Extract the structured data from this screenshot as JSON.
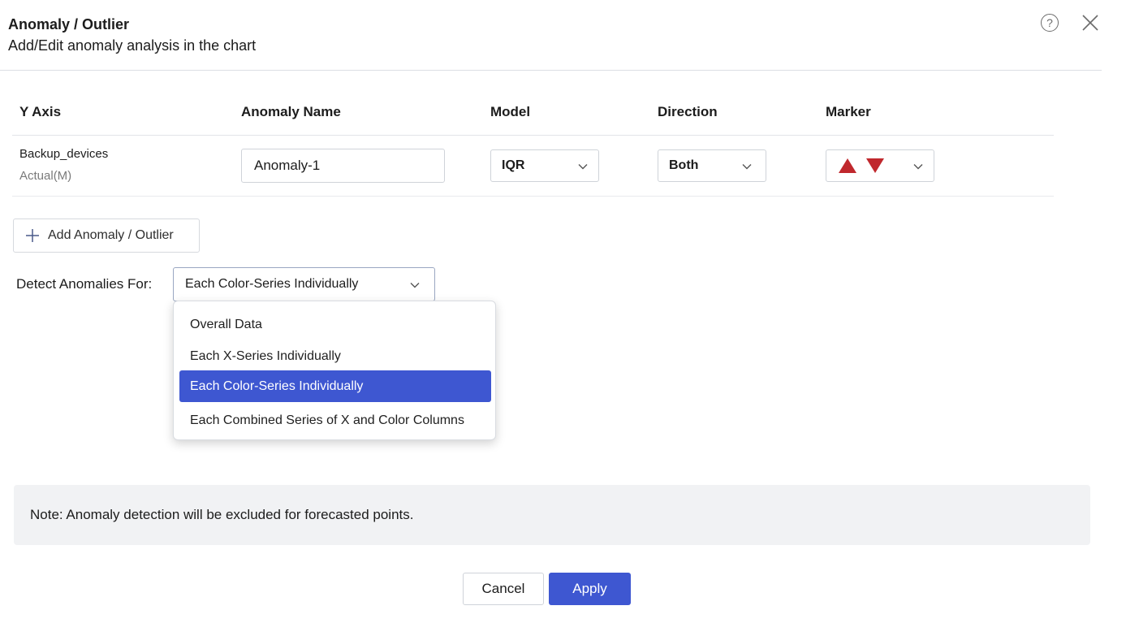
{
  "header": {
    "title": "Anomaly / Outlier",
    "subtitle": "Add/Edit anomaly analysis in the chart",
    "help_glyph": "?",
    "help_icon": "question-circle-icon",
    "close_icon": "close-icon"
  },
  "table": {
    "columns": [
      "Y Axis",
      "Anomaly Name",
      "Model",
      "Direction",
      "Marker"
    ],
    "rows": [
      {
        "y_axis_name": "Backup_devices",
        "y_axis_sub": "Actual(M)",
        "anomaly_name": "Anomaly-1",
        "model": "IQR",
        "direction": "Both",
        "marker_icons": [
          "triangle-up-icon",
          "triangle-down-icon"
        ],
        "marker_color": "#c0282d"
      }
    ]
  },
  "add_button": {
    "label": "Add Anomaly / Outlier",
    "icon": "plus-icon"
  },
  "detect": {
    "label": "Detect Anomalies For:",
    "selected": "Each Color-Series Individually",
    "options": [
      "Overall Data",
      "Each X-Series Individually",
      "Each Color-Series Individually",
      "Each Combined Series of X and Color Columns"
    ],
    "selected_index": 2
  },
  "note": {
    "text": "Note: Anomaly detection will be excluded for forecasted points."
  },
  "footer": {
    "cancel_label": "Cancel",
    "apply_label": "Apply"
  },
  "colors": {
    "accent": "#3e57d1",
    "marker": "#c0282d",
    "note_bg": "#f1f2f4"
  }
}
